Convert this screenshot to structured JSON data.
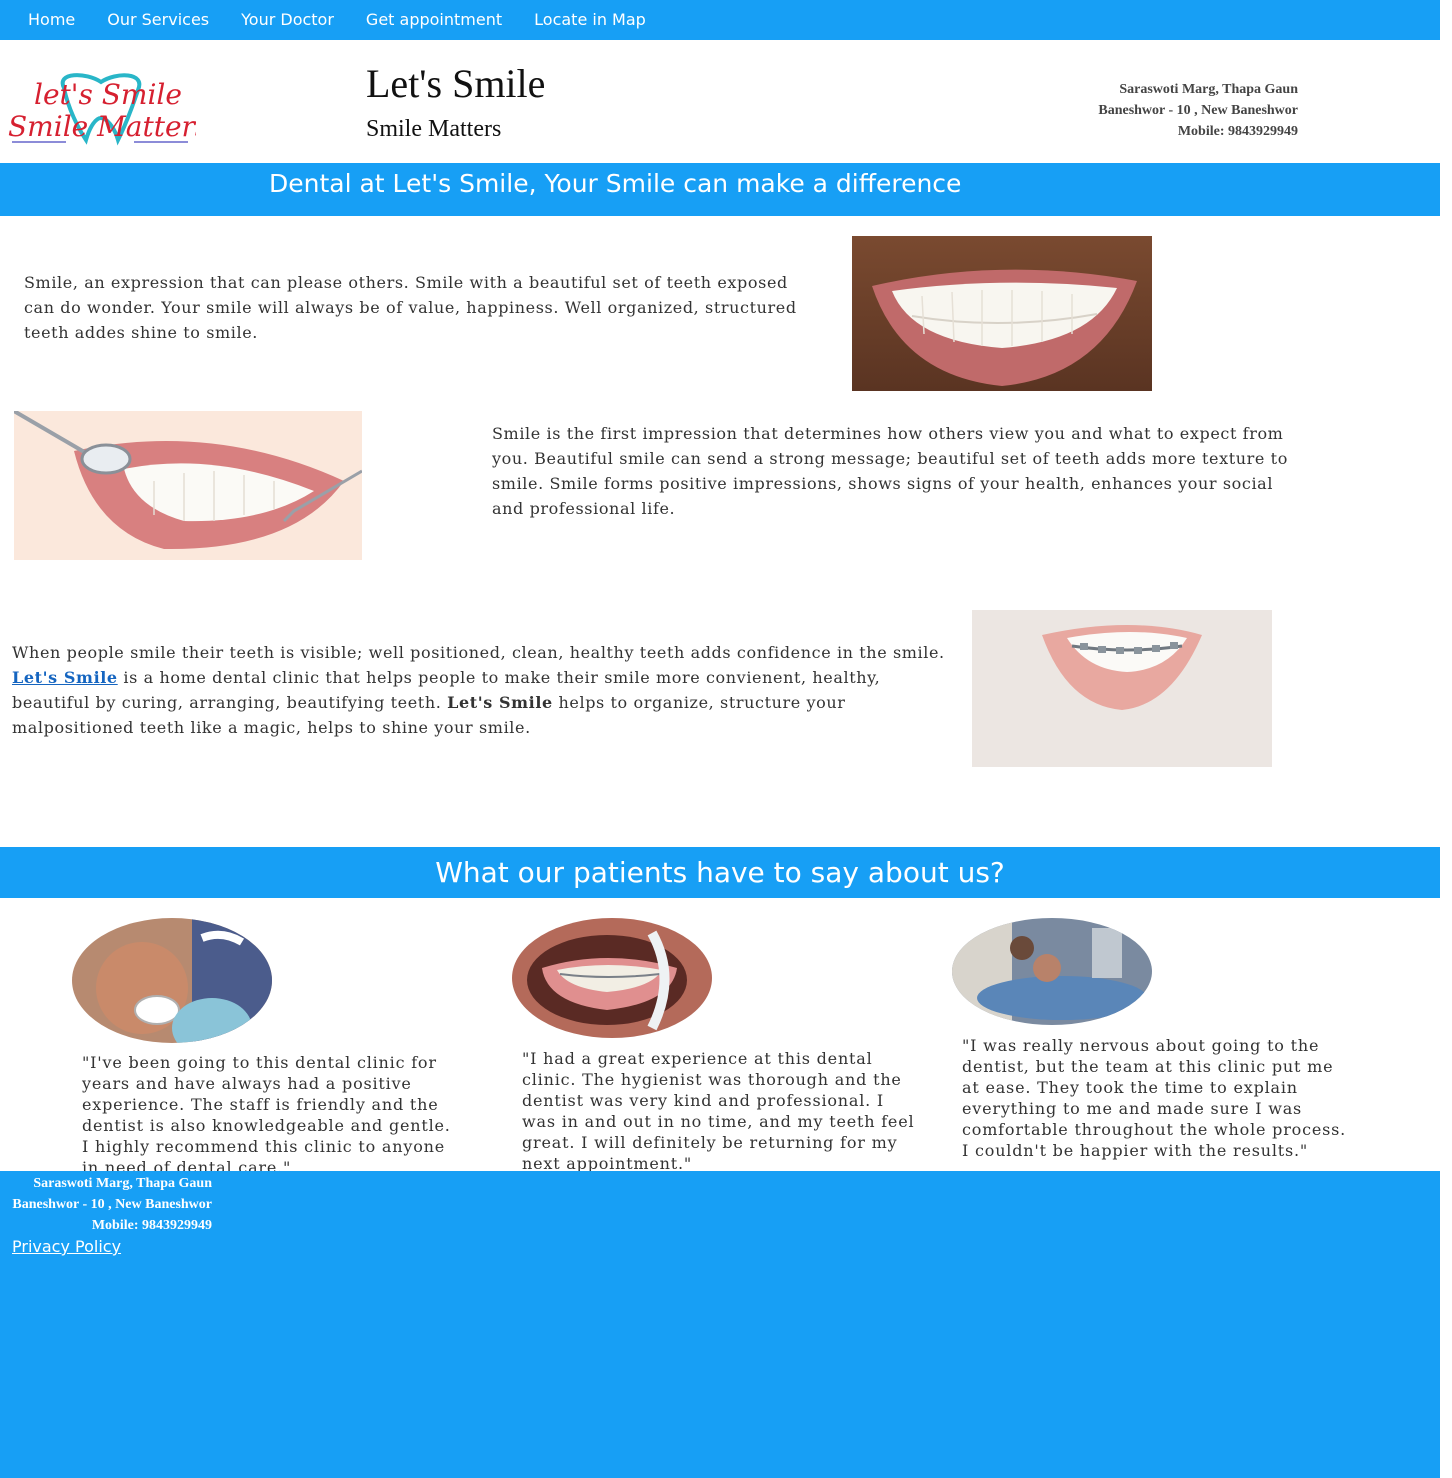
{
  "nav": {
    "items": [
      "Home",
      "Our Services",
      "Your Doctor",
      "Get appointment",
      "Locate in Map"
    ]
  },
  "header": {
    "logo": {
      "line1": "let's Smile",
      "line2": "Smile Matters"
    },
    "title": "Let's Smile",
    "subtitle": "Smile Matters",
    "address": {
      "line1": "Saraswoti Marg, Thapa Gaun",
      "line2": "Baneshwor - 10 , New Baneshwor",
      "line3": "Mobile: 9843929949"
    }
  },
  "banner": {
    "heading": "Dental at Let's Smile, Your Smile can make a difference"
  },
  "sections": {
    "s1": {
      "text": "Smile, an expression that can please others. Smile with a beautiful set of teeth exposed can do wonder. Your smile will always be of value, happiness. Well organized, structured teeth addes shine to smile."
    },
    "s2": {
      "text": "Smile is the first impression that determines how others view you and what to expect from you. Beautiful smile can send a strong message; beautiful set of teeth adds more texture to smile. Smile forms positive impressions, shows signs of your health, enhances your social and professional life."
    },
    "s3": {
      "part1": "When people smile their teeth is visible; well positioned, clean, healthy teeth adds confidence in the smile. ",
      "link": "Let's Smile",
      "part2": " is a home dental clinic that helps people to make their smile more convienent, healthy, beautiful by curing, arranging, beautifying teeth. ",
      "brand": "Let's Smile",
      "part3": " helps to organize, structure your malpositioned teeth like a magic, helps to shine your smile."
    }
  },
  "testimonials": {
    "heading": "What our patients have to say about us?",
    "quotes": [
      "\"I've been going to this dental clinic for years and have always had a positive experience. The staff is friendly and the dentist is also knowledgeable and gentle. I highly recommend this clinic to anyone in need of dental care.\"",
      "\"I had a great experience at this dental clinic. The hygienist was thorough and the dentist was very kind and professional. I was in and out in no time, and my teeth feel great. I will definitely be returning for my next appointment.\"",
      "\"I was really nervous about going to the dentist, but the team at this clinic put me at ease. They took the time to explain everything to me and made sure I was comfortable throughout the whole process. I couldn't be happier with the results.\""
    ]
  },
  "footer": {
    "address": {
      "line1": "Saraswoti Marg, Thapa Gaun",
      "line2": "Baneshwor - 10 , New Baneshwor",
      "line3": "Mobile: 9843929949"
    },
    "privacy": "Privacy Policy"
  },
  "colors": {
    "accent": "#179ff5",
    "link": "#1565c0"
  }
}
